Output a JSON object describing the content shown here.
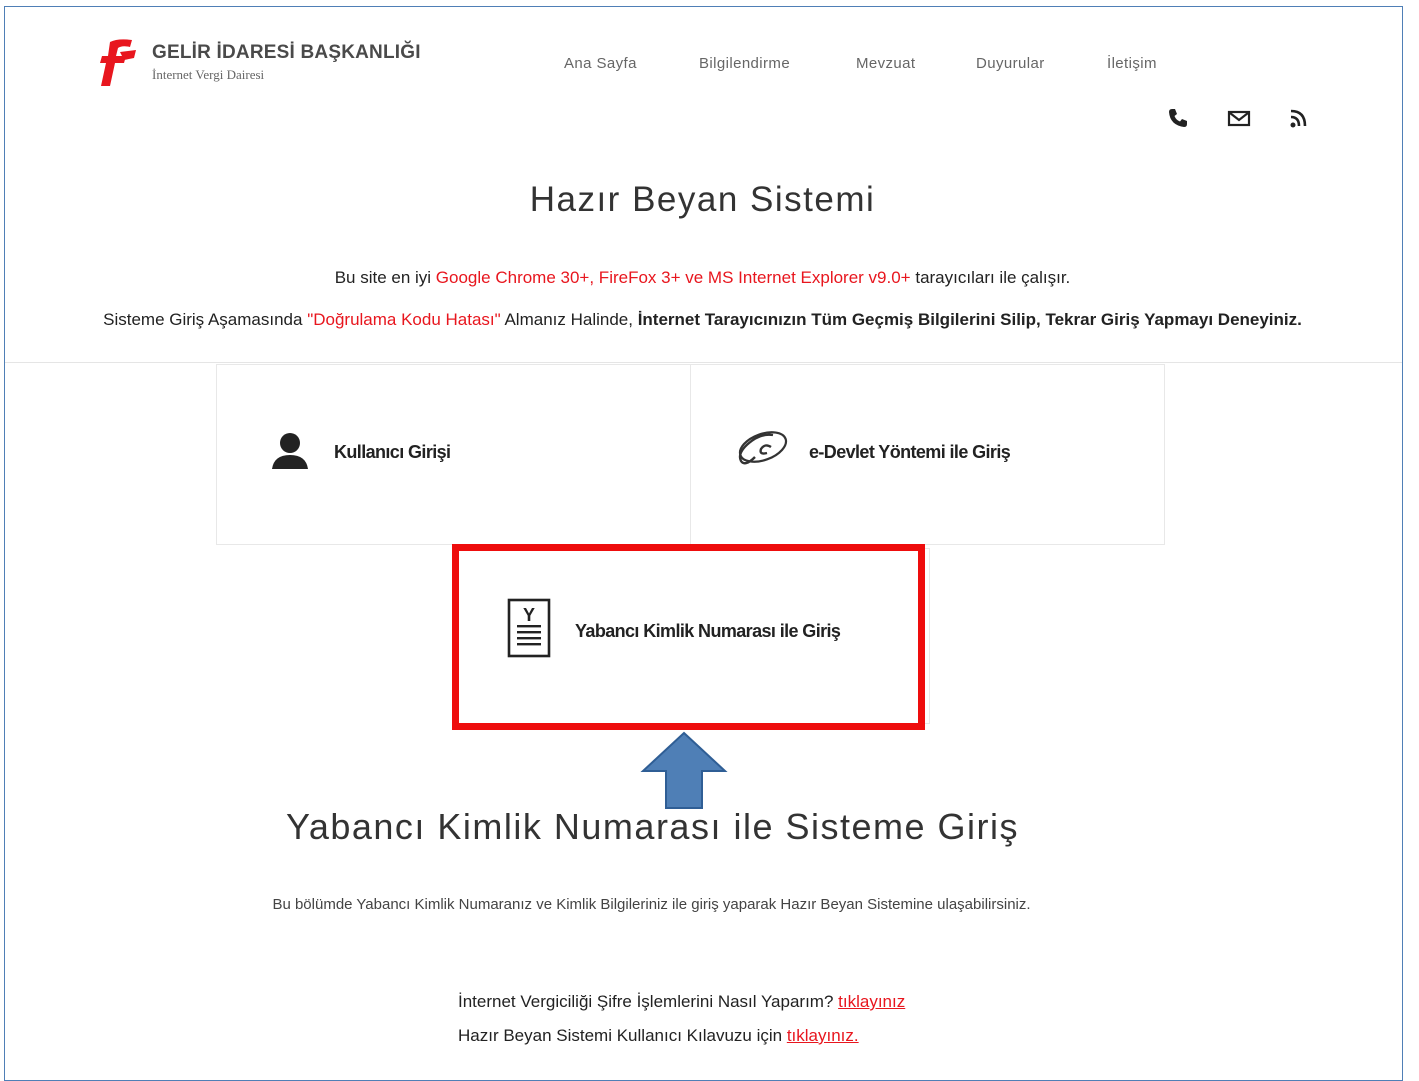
{
  "header": {
    "logo_title": "GELİR İDARESİ BAŞKANLIĞI",
    "logo_subtitle": "İnternet Vergi Dairesi",
    "nav": [
      "Ana Sayfa",
      "Bilgilendirme",
      "Mevzuat",
      "Duyurular",
      "İletişim"
    ],
    "icons": [
      "phone-icon",
      "mail-icon",
      "rss-icon"
    ]
  },
  "main": {
    "title": "Hazır Beyan Sistemi",
    "notice1": {
      "pre": "Bu site en iyi ",
      "highlight": "Google Chrome 30+, FireFox 3+ ve MS Internet Explorer v9.0+",
      "post": " tarayıcıları ile çalışır."
    },
    "notice2": {
      "pre": "Sisteme Giriş Aşamasında ",
      "highlight": "\"Doğrulama Kodu Hatası\"",
      "mid": " Almanız Halinde, ",
      "bold": "İnternet Tarayıcınızın Tüm Geçmiş Bilgilerini Silip, Tekrar Giriş Yapmayı Deneyiniz."
    },
    "login_options": {
      "user_login": "Kullanıcı Girişi",
      "edevlet_login": "e-Devlet Yöntemi ile Giriş",
      "foreign_id_login": "Yabancı Kimlik Numarası ile Giriş"
    },
    "section_title": "Yabancı Kimlik Numarası ile Sisteme Giriş",
    "section_desc": "Bu bölümde Yabancı Kimlik Numaranız ve Kimlik Bilgileriniz ile giriş yaparak Hazır Beyan Sistemine ulaşabilirsiniz.",
    "help1_text": "İnternet Vergiciliği Şifre İşlemlerini Nasıl Yaparım? ",
    "help1_link": "tıklayınız",
    "help2_text": "Hazır Beyan Sistemi Kullanıcı Kılavuzu için ",
    "help2_link": "tıklayınız."
  },
  "colors": {
    "accent_red": "#e8161e",
    "highlight_border": "#ee0d0d",
    "arrow_fill": "#4f7fb6"
  }
}
